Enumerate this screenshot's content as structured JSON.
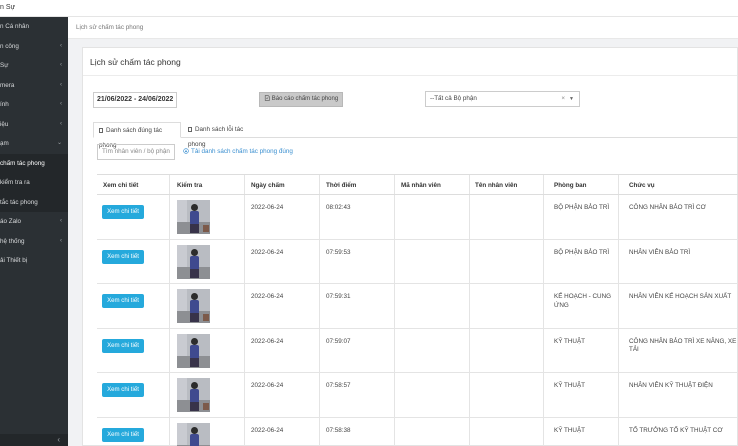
{
  "app": {
    "brand": "n Sự"
  },
  "sidebar": {
    "items": [
      {
        "label": "n Cá nhân",
        "chevron": ""
      },
      {
        "label": "n công",
        "chevron": "‹"
      },
      {
        "label": "Sự",
        "chevron": "‹"
      },
      {
        "label": "mera",
        "chevron": "‹"
      },
      {
        "label": "ính",
        "chevron": "‹"
      },
      {
        "label": "iệu",
        "chevron": "‹"
      },
      {
        "label": "ạm",
        "chevron": "⌄"
      },
      {
        "label": "chấm tác phong",
        "chevron": ""
      },
      {
        "label": "kiểm tra ra",
        "chevron": ""
      },
      {
        "label": "tắc tác phong",
        "chevron": ""
      },
      {
        "label": "áo Zalo",
        "chevron": "‹"
      },
      {
        "label": "hệ thống",
        "chevron": "‹"
      },
      {
        "label": "ải Thiết bị",
        "chevron": ""
      }
    ],
    "collapse": "‹"
  },
  "breadcrumb": "Lịch sử chấm tác phong",
  "panel": {
    "title": "Lịch sử chấm tác phong",
    "date_range": "21/06/2022 - 24/06/2022",
    "report_button": "Báo cáo chấm tác phong",
    "department_select": "--Tất cả Bộ phận",
    "tabs": [
      "Danh sách đúng tác phong",
      "Danh sách lỗi tác phong"
    ],
    "search_placeholder": "Tìm nhân viên / bộ phận",
    "download_link": "Tải danh sách chấm tác phong đúng"
  },
  "table": {
    "headers": [
      "Xem chi tiết",
      "Kiểm tra",
      "Ngày chấm",
      "Thời điểm",
      "Mã nhân viên",
      "Tên nhân viên",
      "Phòng ban",
      "Chức vụ"
    ],
    "view_label": "Xem chi tiết",
    "rows": [
      {
        "date": "2022-06-24",
        "time": "08:02:43",
        "code": "",
        "name": "",
        "dept": "BỘ PHẬN BẢO TRÌ",
        "position": "CÔNG NHÂN BẢO TRÌ CƠ"
      },
      {
        "date": "2022-06-24",
        "time": "07:59:53",
        "code": "",
        "name": "",
        "dept": "BỘ PHẬN BẢO TRÌ",
        "position": "NHÂN VIÊN BẢO TRÌ"
      },
      {
        "date": "2022-06-24",
        "time": "07:59:31",
        "code": "",
        "name": "",
        "dept": "KẾ HOẠCH - CUNG ỨNG",
        "position": "NHÂN VIÊN KẾ HOẠCH SẢN XUẤT"
      },
      {
        "date": "2022-06-24",
        "time": "07:59:07",
        "code": "",
        "name": "",
        "dept": "KỸ THUẬT",
        "position": "CÔNG NHÂN BẢO TRÌ XE NÂNG, XE TẢI"
      },
      {
        "date": "2022-06-24",
        "time": "07:58:57",
        "code": "",
        "name": "",
        "dept": "KỸ THUẬT",
        "position": "NHÂN VIÊN KỸ THUẬT ĐIỆN"
      },
      {
        "date": "2022-06-24",
        "time": "07:58:38",
        "code": "",
        "name": "",
        "dept": "KỸ THUẬT",
        "position": "TỔ TRƯỞNG TỔ KỸ THUẬT CƠ"
      }
    ]
  },
  "icons": {
    "report": "report-icon",
    "download": "download-icon",
    "bookmark": "bookmark-icon",
    "clear": "clear-icon",
    "dropdown": "caret-down-icon"
  },
  "colors": {
    "sidebar_bg": "#2b3034",
    "primary_button": "#25a9dc",
    "link": "#3a8fd0"
  }
}
